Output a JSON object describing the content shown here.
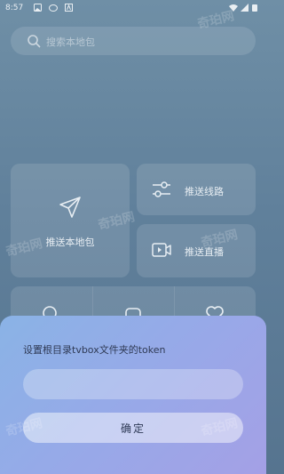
{
  "status": {
    "time": "8:57"
  },
  "search": {
    "placeholder": "搜索本地包"
  },
  "cards": {
    "push_local": "推送本地包",
    "push_route": "推送线路",
    "push_live": "推送直播"
  },
  "dialog": {
    "title": "设置根目录tvbox文件夹的token",
    "input_value": "",
    "confirm_label": "确定"
  },
  "watermark": "奇珀网"
}
